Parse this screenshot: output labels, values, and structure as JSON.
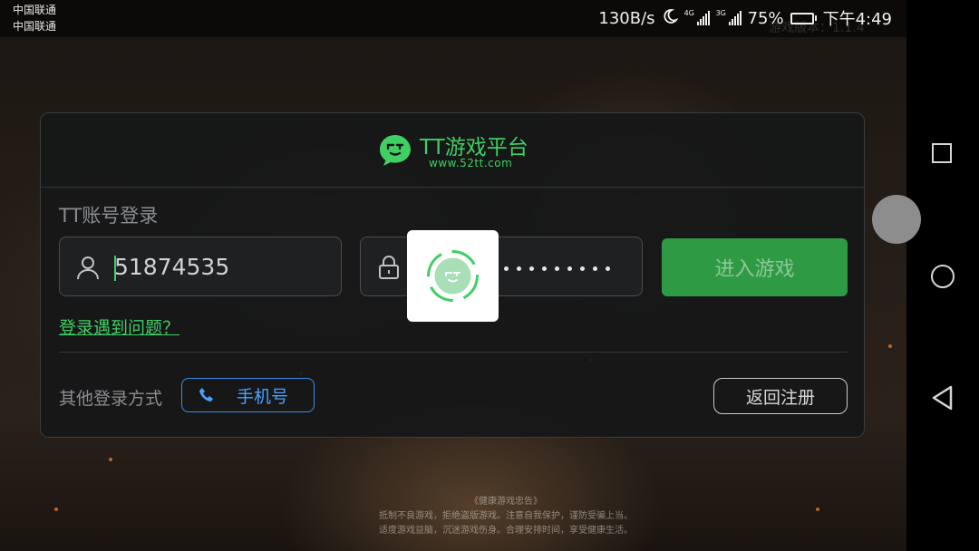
{
  "status_bar": {
    "carrier_1": "中国联通",
    "carrier_2": "中国联通",
    "faded_version_text": "游戏版本：1.1.4",
    "net_speed": "130B/s",
    "signal_1_tag": "4G",
    "signal_2_tag": "3G",
    "battery": "75%",
    "battery_level": 0.75,
    "time": "下午4:49"
  },
  "login_panel": {
    "brand_title": "TT游戏平台",
    "brand_url": "www.52tt.com",
    "title": "TT账号登录",
    "username_value": "51874535",
    "password_masked_length": 9,
    "enter_button": "进入游戏",
    "help_link": "登录遇到问题？",
    "other_methods_label": "其他登录方式",
    "phone_button": "手机号",
    "back_button": "返回注册"
  },
  "health_notice": {
    "title": "《健康游戏忠告》",
    "line_1": "抵制不良游戏，拒绝盗版游戏。注意自我保护，谨防受骗上当。",
    "line_2": "适度游戏益脑，沉迷游戏伤身。合理安排时间，享受健康生活。"
  },
  "colors": {
    "brand_green": "#3fcf63",
    "enter_button_bg": "#2f9a44",
    "phone_blue": "#3a8ee8",
    "panel_bg": "#161718"
  },
  "icons": [
    "user-icon",
    "lock-icon",
    "phone-icon",
    "tt-chat-logo-icon",
    "loading-spinner-icon",
    "moon-icon"
  ]
}
